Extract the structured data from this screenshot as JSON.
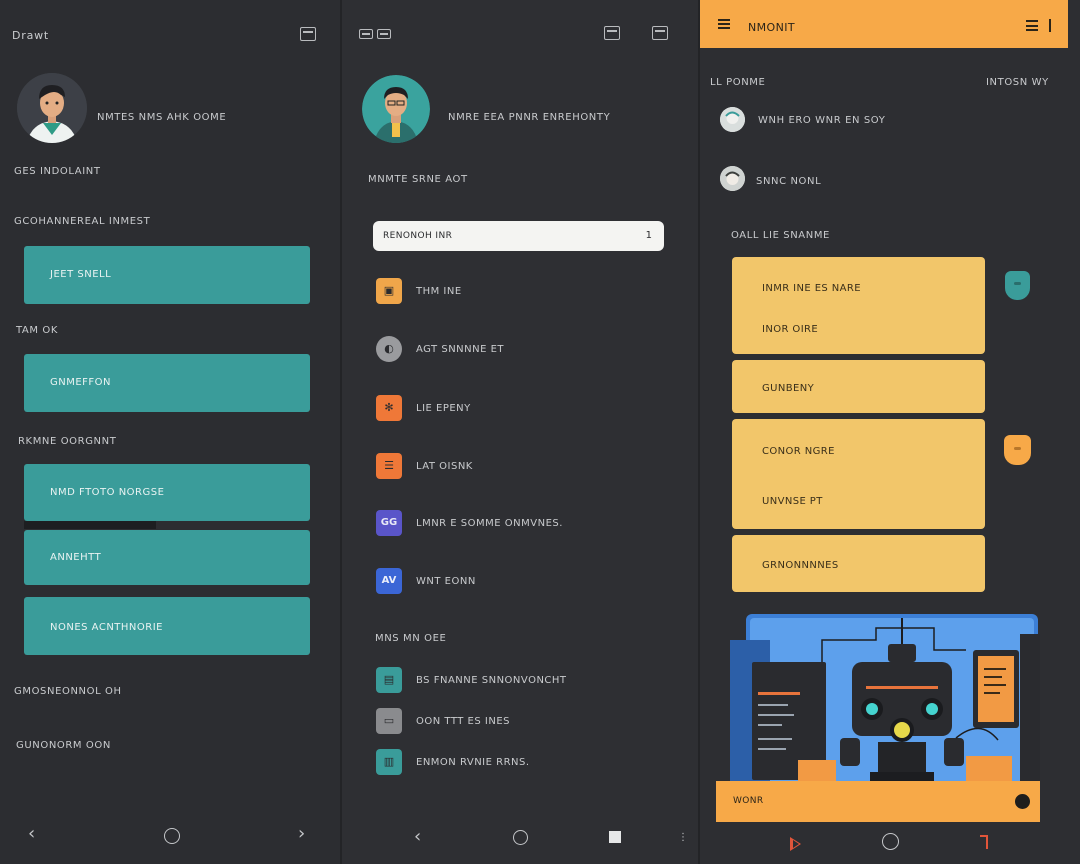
{
  "panel_left": {
    "app_title": "Drawt",
    "profile_name": "Nmtes nms ahk oome",
    "section1": "Ges indolaint",
    "section2": "Gcohannereal inmest",
    "button1": "Jeet snell",
    "section3": "Tam ok",
    "button2": "Gnmeffon",
    "section4": "Rkmne oorgnnt",
    "button3": "Nmd ftoto norgse",
    "button4": "Annehtt",
    "button5": "Nones acnthnorie",
    "footer1": "Gmosneonnol oh",
    "footer2": "Gunonorm oon",
    "accent": "#3a9c9a"
  },
  "panel_middle": {
    "profile_name": "Nmre eea pnnr enrehonty",
    "section1": "Mnmte srne aot",
    "search_value": "Renonoh inr",
    "search_count": "1",
    "menu": [
      {
        "label": "Thm ine",
        "icon": "grid-icon",
        "color": "#f0a64a",
        "glyph": "▣"
      },
      {
        "label": "Agt snnnne et",
        "icon": "clock-icon",
        "color": "#9a9b9e",
        "glyph": "◐"
      },
      {
        "label": "Lie epeny",
        "icon": "star-icon",
        "color": "#ef7838",
        "glyph": "✻"
      },
      {
        "label": "Lat oisnk",
        "icon": "list-icon",
        "color": "#ef7838",
        "glyph": "☰"
      },
      {
        "label": "Lmnr e somme onmvnes.",
        "icon": "people-icon",
        "color": "#5a55c9",
        "glyph": "GG"
      },
      {
        "label": "Wnt eonn",
        "icon": "chart-icon",
        "color": "#3b66d6",
        "glyph": "AV"
      }
    ],
    "section2": "Mns mn oee",
    "menu2": [
      {
        "label": "Bs fnanne snnonvoncht",
        "icon": "card-icon",
        "color": "#3a9c9a",
        "glyph": "▤"
      },
      {
        "label": "Oon ttt es ines",
        "icon": "doc-icon",
        "color": "#8a8b8e",
        "glyph": "▭"
      },
      {
        "label": "Enmon rvnie rrns.",
        "icon": "chat-icon",
        "color": "#3a9c9a",
        "glyph": "▥"
      }
    ]
  },
  "panel_right": {
    "title": "Nmonit",
    "col_left": "Ll ponme",
    "col_right": "Intosn wy",
    "contacts": [
      {
        "name": "Wnh ero wnr en soy"
      },
      {
        "name": "Snnc nonl"
      }
    ],
    "section": "Oall lie snanme",
    "cards": [
      {
        "line1": "Inmr ine es nare",
        "line2": "Inor oire"
      },
      {
        "line1": "Gunbeny"
      },
      {
        "line1": "Conor ngre",
        "line2": "Unvnse pt"
      },
      {
        "line1": "Grnonnnnes"
      }
    ],
    "bottom_bar": "Wonr",
    "accent": "#f7a948",
    "card_color": "#f2c66a"
  }
}
